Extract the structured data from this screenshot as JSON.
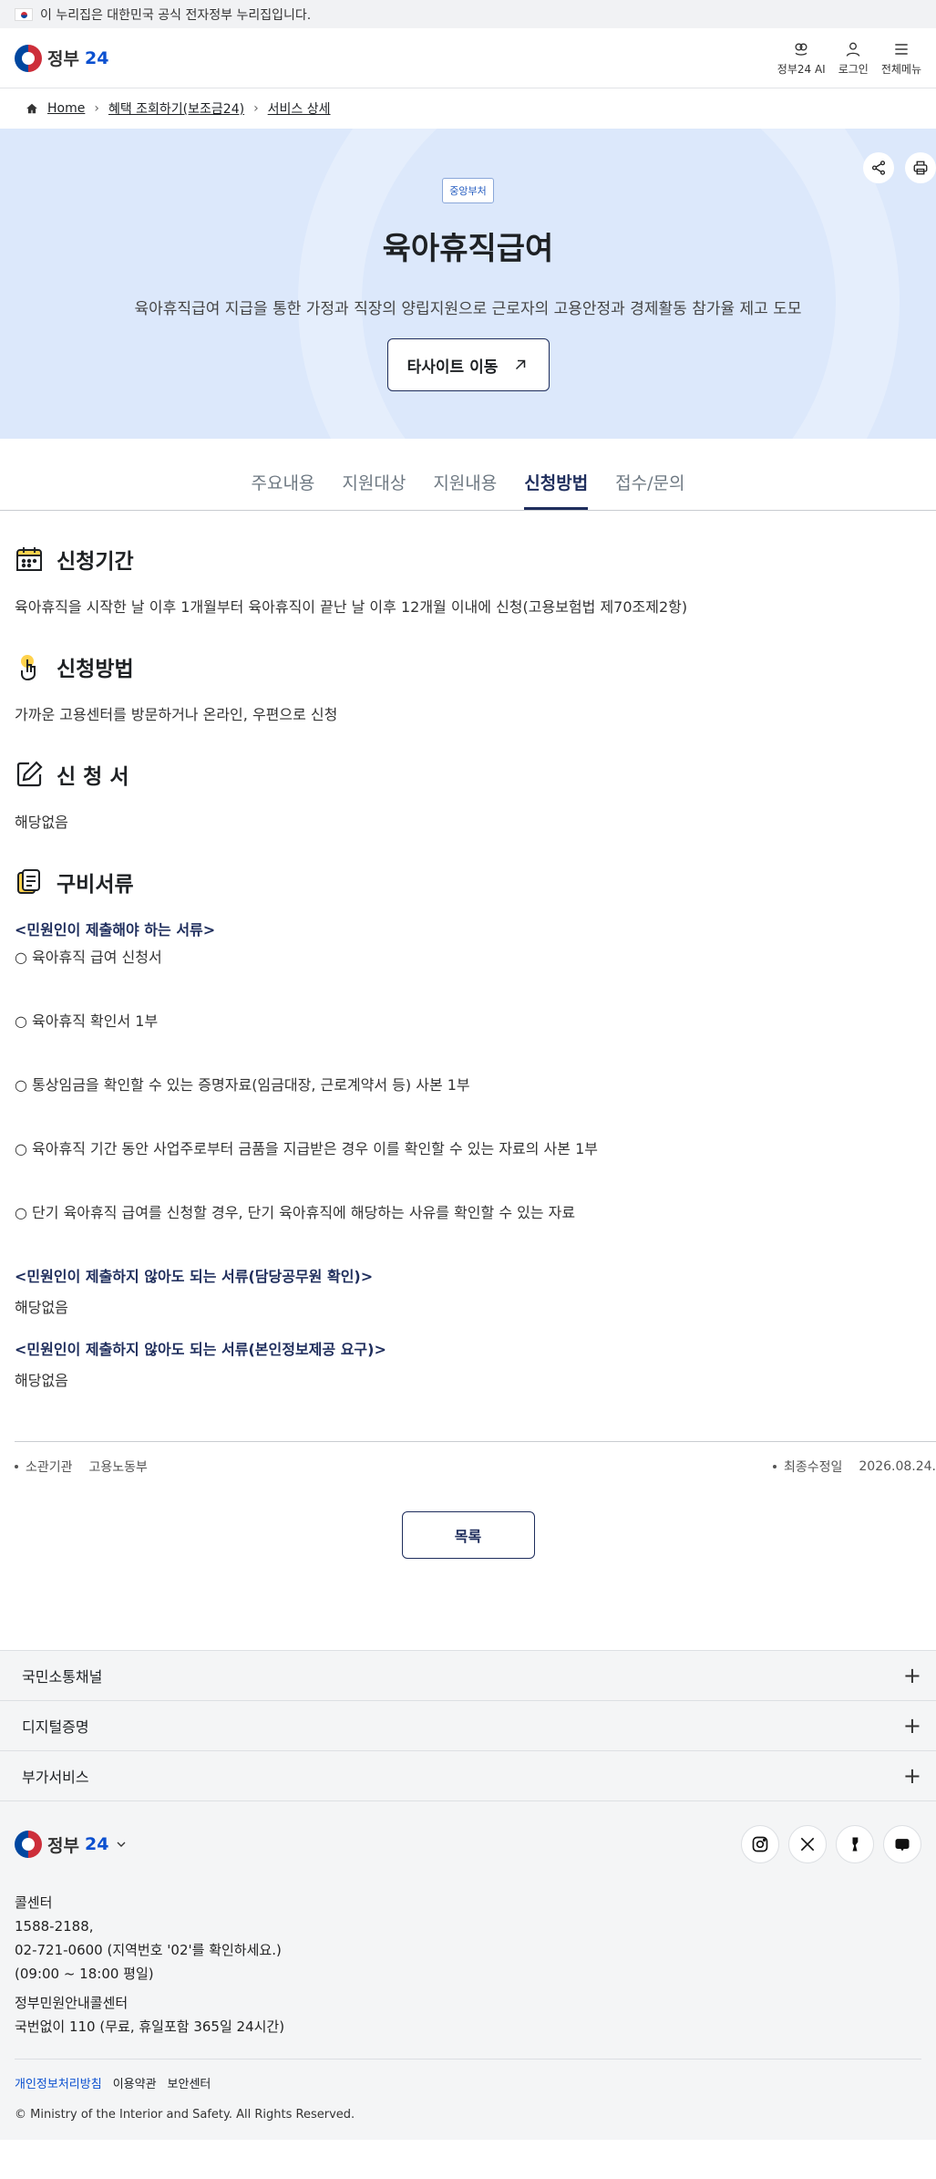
{
  "gov_banner": {
    "text": "이 누리집은 대한민국 공식 전자정부 누리집입니다."
  },
  "header": {
    "logo_text": "정부",
    "logo_num": "24",
    "actions": [
      {
        "label": "정부24 AI",
        "icon": "ai-icon"
      },
      {
        "label": "로그인",
        "icon": "user-icon"
      },
      {
        "label": "전체메뉴",
        "icon": "menu-icon"
      }
    ]
  },
  "breadcrumb": [
    "Home",
    "혜택 조회하기(보조금24)",
    "서비스 상세"
  ],
  "hero": {
    "badge": "중앙부처",
    "title": "육아휴직급여",
    "description": "육아휴직급여 지급을 통한 가정과 직장의 양립지원으로 근로자의 고용안정과 경제활동 참가율 제고 도모",
    "button": "타사이트 이동"
  },
  "tabs": [
    "주요내용",
    "지원대상",
    "지원내용",
    "신청방법",
    "접수/문의"
  ],
  "active_tab": "신청방법",
  "sections": {
    "period": {
      "title": "신청기간",
      "body": "육아휴직을 시작한 날 이후 1개월부터 육아휴직이 끝난 날 이후 12개월 이내에 신청(고용보험법 제70조제2항)"
    },
    "method": {
      "title": "신청방법",
      "body": "가까운 고용센터를 방문하거나 온라인, 우편으로 신청"
    },
    "form": {
      "title": "신 청 서",
      "body": "해당없음"
    },
    "docs": {
      "title": "구비서류",
      "sub1": "<민원인이 제출해야 하는 서류>",
      "items": [
        "○ 육아휴직 급여 신청서",
        "○ 육아휴직 확인서 1부",
        "○ 통상임금을 확인할 수 있는 증명자료(임금대장, 근로계약서 등) 사본 1부",
        "○ 육아휴직 기간 동안 사업주로부터 금품을 지급받은 경우 이를 확인할 수 있는 자료의 사본 1부",
        "○ 단기 육아휴직 급여를 신청할 경우, 단기 육아휴직에 해당하는 사유를 확인할 수 있는 자료"
      ],
      "sub2": "<민원인이 제출하지 않아도 되는 서류(담당공무원 확인)>",
      "sub2_body": "해당없음",
      "sub3": "<민원인이 제출하지 않아도 되는 서류(본인정보제공 요구)>",
      "sub3_body": "해당없음"
    }
  },
  "meta": {
    "agency_label": "소관기관",
    "agency": "고용노동부",
    "updated_label": "최종수정일",
    "updated": "2026.08.24."
  },
  "list_button": "목록",
  "accordion": [
    "국민소통채널",
    "디지털증명",
    "부가서비스"
  ],
  "footer": {
    "logo_text": "정부",
    "logo_num": "24",
    "lines": [
      "콜센터",
      "1588-2188,",
      "02-721-0600 (지역번호 '02'를 확인하세요.)",
      "(09:00 ~ 18:00 평일)"
    ],
    "lines2": [
      "정부민원안내콜센터",
      "국번없이 110 (무료, 휴일포함 365일 24시간)"
    ],
    "links": [
      "개인정보처리방침",
      "이용약관",
      "보안센터"
    ],
    "copyright": "© Ministry of the Interior and Safety. All Rights Reserved.",
    "socials": [
      "instagram-icon",
      "x-icon",
      "kakao-story-icon",
      "blog-icon"
    ]
  }
}
